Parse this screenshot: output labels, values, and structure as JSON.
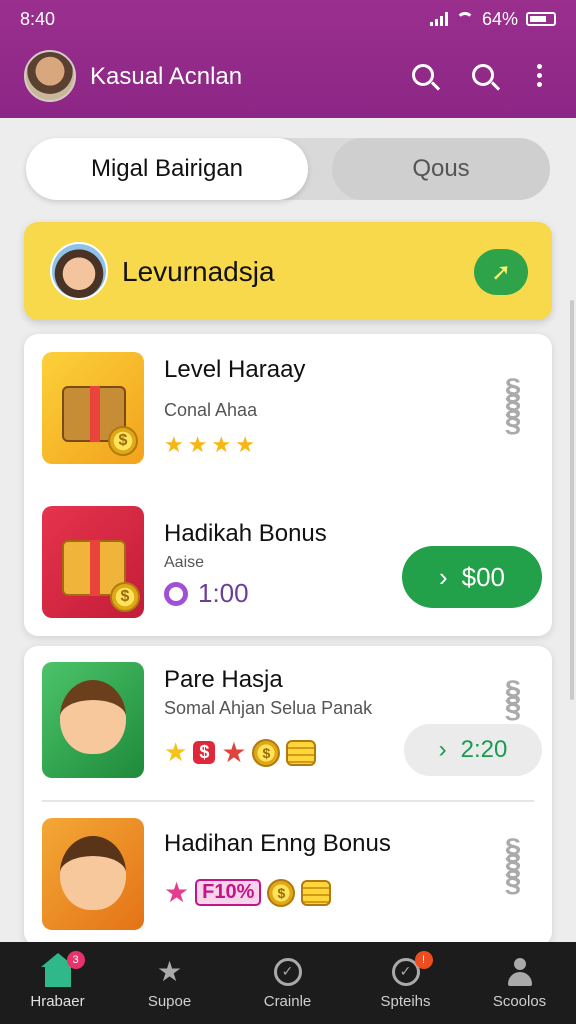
{
  "status_bar": {
    "time": "8:40",
    "battery": "64%"
  },
  "header": {
    "title": "Kasual Acnlan"
  },
  "tabs": [
    {
      "label": "Migal Bairigan",
      "active": true
    },
    {
      "label": "Qous",
      "active": false
    }
  ],
  "banner": {
    "title": "Levurnadsja",
    "go_icon": "arrow-right-icon"
  },
  "cards": [
    {
      "items": [
        {
          "title": "Level Haraay",
          "subtitle": "Conal Ahaa",
          "rating": 4
        },
        {
          "title": "Hadikah Bonus",
          "subtitle": "Aaise",
          "timer": "1:00",
          "action_label": "$00"
        }
      ]
    },
    {
      "items": [
        {
          "title": "Pare Hasja",
          "subtitle": "Somal Ahjan Selua Panak",
          "action_label": "2:20",
          "badge_text": "$"
        },
        {
          "title": "Hadihan Enng Bonus",
          "badge_text": "F10%"
        }
      ]
    }
  ],
  "bottom_nav": [
    {
      "label": "Hrabaer",
      "badge": "3",
      "icon": "home-icon",
      "active": true
    },
    {
      "label": "Supoe",
      "icon": "star-icon"
    },
    {
      "label": "Crainle",
      "icon": "compass-icon"
    },
    {
      "label": "Spteihs",
      "badge": "!",
      "icon": "check-circle-icon"
    },
    {
      "label": "Scoolos",
      "icon": "profile-icon"
    }
  ],
  "colors": {
    "header": "#8c2685",
    "banner": "#f8d94b",
    "accent_green": "#22a04a",
    "nav_bg": "#1c1c1c"
  }
}
